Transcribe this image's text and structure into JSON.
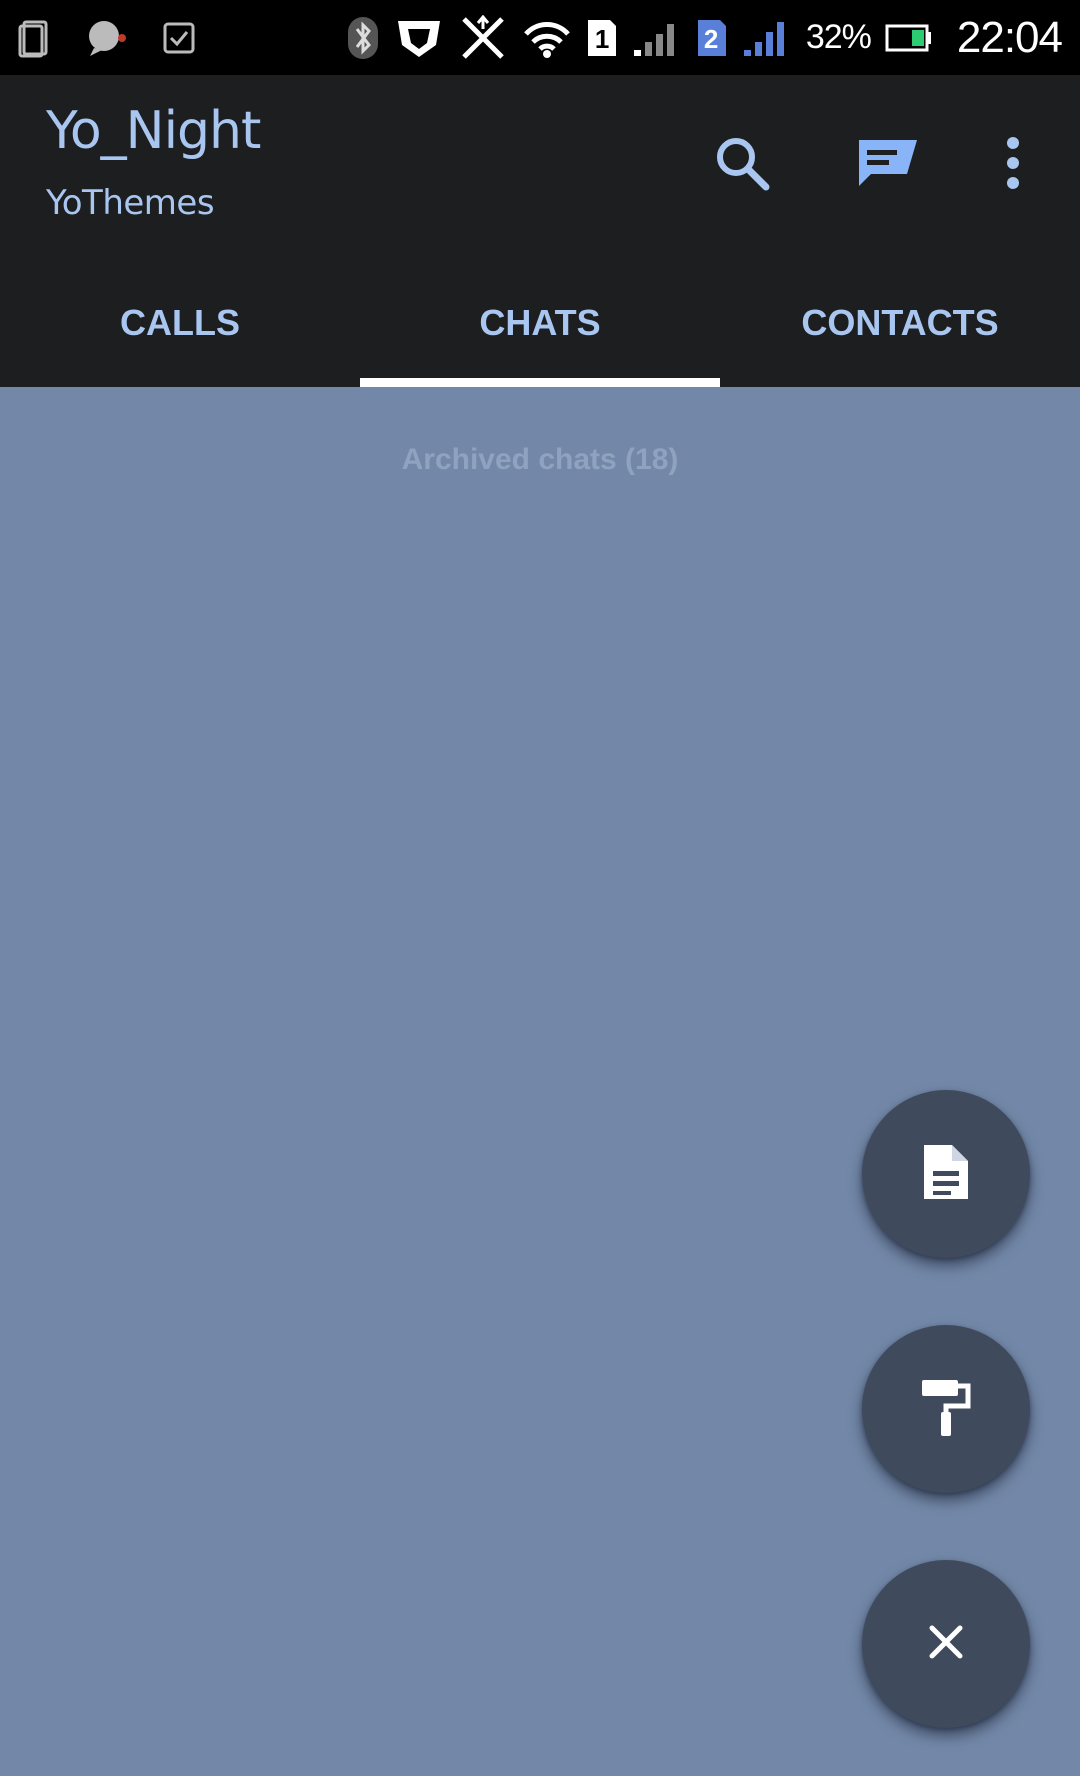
{
  "status_bar": {
    "battery_percent": "32%",
    "time": "22:04",
    "sim1_label": "1",
    "sim2_label": "2",
    "icons": [
      "screenshot-icon",
      "chat-bubble-icon",
      "checkbox-icon",
      "bluetooth-icon",
      "shield-icon",
      "data-transfer-icon",
      "wifi-hotspot-icon",
      "sim1-icon",
      "signal-icon",
      "sim2-icon",
      "signal-icon",
      "battery-icon"
    ]
  },
  "app_bar": {
    "title": "Yo_Night",
    "subtitle": "YoThemes",
    "actions": [
      "search-icon",
      "compose-icon",
      "more-vert-icon"
    ]
  },
  "tabs": [
    {
      "label": "CALLS",
      "active": false
    },
    {
      "label": "CHATS",
      "active": true
    },
    {
      "label": "CONTACTS",
      "active": false
    }
  ],
  "content": {
    "archived_label": "Archived chats (18)"
  },
  "fabs": [
    "document-icon",
    "paint-roller-icon",
    "close-icon"
  ],
  "colors": {
    "status_bar_bg": "#000000",
    "app_bar_bg": "#1d1e20",
    "accent_text": "#a9c6f0",
    "content_bg": "#7388a8",
    "fab_bg": "#3f4a5c",
    "compose_icon": "#8ab4f8"
  }
}
